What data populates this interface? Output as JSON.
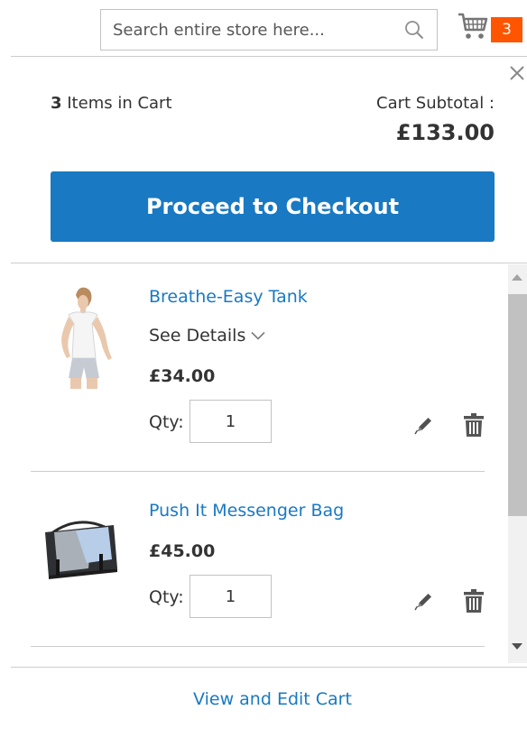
{
  "header": {
    "search": {
      "value": "",
      "placeholder": "Search entire store here..."
    },
    "cart_counter": "3"
  },
  "minicart": {
    "items_count_number": "3",
    "items_count_label": " Items in Cart",
    "subtotal_label": "Cart Subtotal :",
    "subtotal_amount": "£133.00",
    "checkout_label": "Proceed to Checkout",
    "view_cart_label": "View and Edit Cart",
    "items": [
      {
        "name": "Breathe-Easy Tank",
        "see_details_label": "See Details",
        "price": "£34.00",
        "qty_label": "Qty:",
        "qty": "1"
      },
      {
        "name": "Push It Messenger Bag",
        "price": "£45.00",
        "qty_label": "Qty:",
        "qty": "1"
      }
    ]
  },
  "colors": {
    "accent": "#1979c3",
    "counter": "#ff5501",
    "text": "#333333",
    "divider": "#cccccc"
  },
  "icons": [
    "search-icon",
    "cart-icon",
    "close-icon",
    "chevron-down-icon",
    "edit-icon",
    "trash-icon"
  ]
}
